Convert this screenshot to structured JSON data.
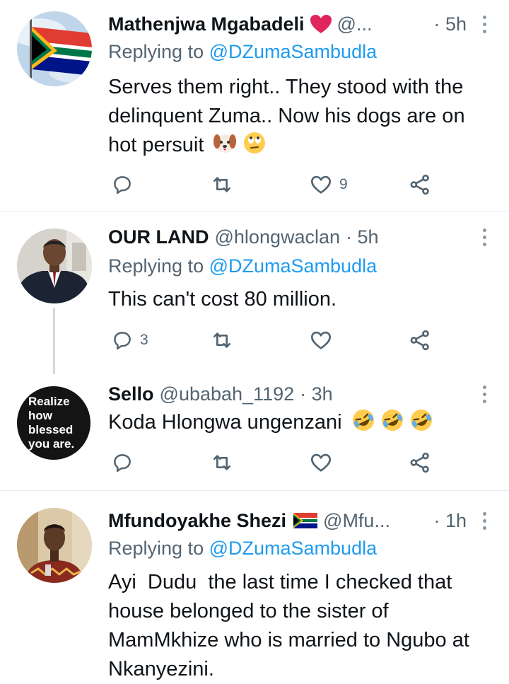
{
  "tweets": [
    {
      "name": "Mathenjwa Mgabadeli",
      "handle": "@...",
      "time": "· 5h",
      "replying_prefix": "Replying to ",
      "replying_to": "@DZumaSambudla",
      "text_lines": [
        "Serves them right.. They stood with the",
        "delinquent Zuma.. Now his dogs are on",
        "hot persuit"
      ],
      "reply_count": "",
      "retweet_count": "",
      "like_count": "9"
    },
    {
      "name": "OUR LAND",
      "handle": "@hlongwaclan",
      "time": "· 5h",
      "replying_prefix": "Replying to ",
      "replying_to": "@DZumaSambudla",
      "text_lines": [
        "This can't cost 80 million."
      ],
      "reply_count": "3",
      "retweet_count": "",
      "like_count": ""
    },
    {
      "name": "Sello",
      "handle": "@ubabah_1192",
      "time": "· 3h",
      "text_lines": [
        "Koda Hlongwa ungenzani"
      ],
      "avatar_text": [
        "Realize",
        "how",
        "blessed",
        "you are."
      ],
      "reply_count": "",
      "retweet_count": "",
      "like_count": ""
    },
    {
      "name": "Mfundoyakhe Shezi",
      "handle": "@Mfu...",
      "time": "· 1h",
      "replying_prefix": "Replying to ",
      "replying_to": "@DZumaSambudla",
      "text_lines": [
        "Ayi  Dudu  the last time I checked that",
        "house belonged to the sister of",
        "MamMkhize who is married to Ngubo at",
        "Nkanyezini."
      ]
    }
  ],
  "icons": [
    "red-heart-icon",
    "dog-face-icon",
    "eye-roll-face-icon",
    "rolling-laughing-icon",
    "south-africa-flag-icon",
    "reply-icon",
    "retweet-icon",
    "like-icon",
    "share-icon",
    "more-options-icon"
  ],
  "colors": {
    "accent": "#1d9bf0",
    "secondary_text": "#536471",
    "heart": "#e0245e",
    "divider": "#e6ecf0"
  }
}
